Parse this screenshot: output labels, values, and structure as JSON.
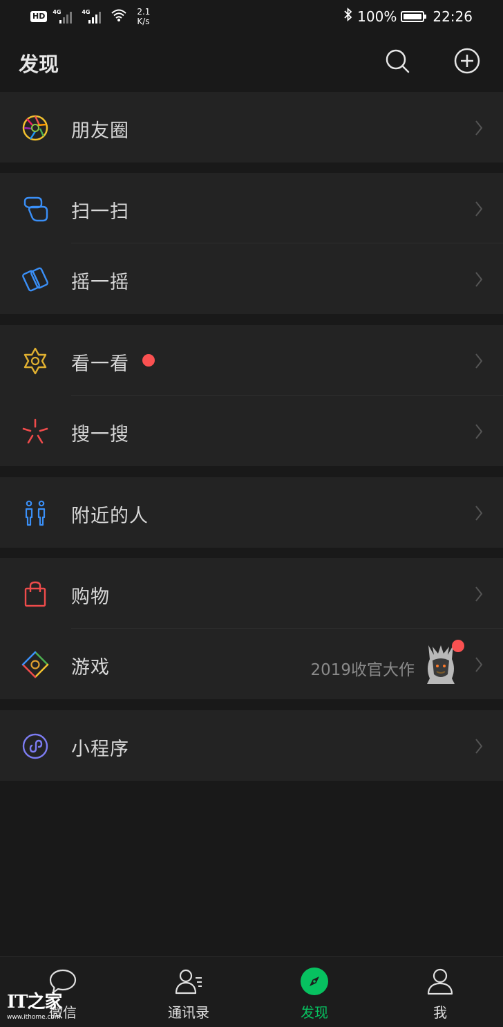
{
  "status_bar": {
    "hd": "HD",
    "sim1_tag": "4G",
    "sim2_tag": "4G",
    "speed_value": "2.1",
    "speed_unit": "K/s",
    "battery": "100%",
    "time": "22:26"
  },
  "header": {
    "title": "发现",
    "search_icon": "search-icon",
    "add_icon": "plus-circle-icon"
  },
  "groups": [
    {
      "items": [
        {
          "label": "朋友圈",
          "icon": "moments-aperture-icon"
        }
      ]
    },
    {
      "items": [
        {
          "label": "扫一扫",
          "icon": "scan-icon"
        },
        {
          "label": "摇一摇",
          "icon": "shake-icon"
        }
      ]
    },
    {
      "items": [
        {
          "label": "看一看",
          "icon": "top-stories-icon",
          "badge": "red-dot"
        },
        {
          "label": "搜一搜",
          "icon": "search-sparkle-icon"
        }
      ]
    },
    {
      "items": [
        {
          "label": "附近的人",
          "icon": "people-nearby-icon"
        }
      ]
    },
    {
      "items": [
        {
          "label": "购物",
          "icon": "shopping-bag-icon"
        },
        {
          "label": "游戏",
          "icon": "games-icon",
          "subtext": "2019收官大作",
          "badge": "red-dot"
        }
      ]
    },
    {
      "items": [
        {
          "label": "小程序",
          "icon": "mini-program-icon"
        }
      ]
    }
  ],
  "tabbar": {
    "tabs": [
      {
        "label": "微信",
        "icon": "chat-bubble-icon"
      },
      {
        "label": "通讯录",
        "icon": "contacts-icon"
      },
      {
        "label": "发现",
        "icon": "discover-compass-icon",
        "active": true
      },
      {
        "label": "我",
        "icon": "me-person-icon"
      }
    ]
  },
  "watermark": {
    "logo": "IT之家",
    "url": "www.ithome.com"
  },
  "colors": {
    "background": "#191919",
    "cell": "#232323",
    "active_green": "#07c160",
    "badge_red": "#fa5151"
  }
}
